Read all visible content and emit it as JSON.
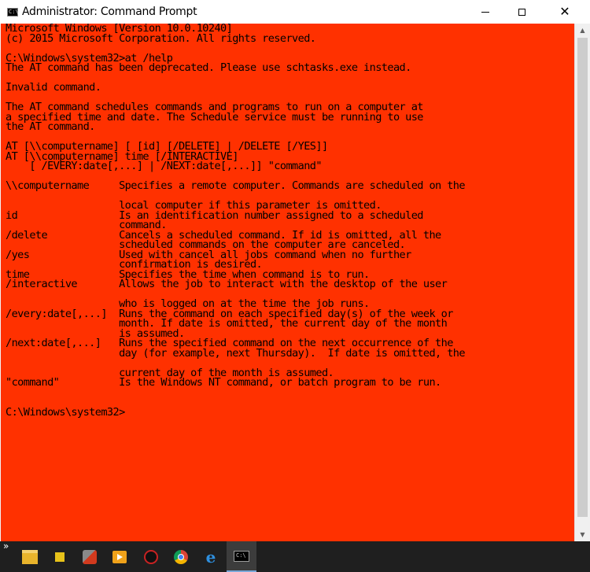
{
  "window": {
    "title": "Administrator: Command Prompt",
    "icon": "cmd-icon",
    "controls": {
      "minimize": "minimize-icon",
      "maximize": "maximize-icon",
      "close_glyph": "✕"
    }
  },
  "console": {
    "background_color": "#ff3100",
    "text_color": "#000000",
    "lines": [
      "Microsoft Windows [Version 10.0.10240]",
      "(c) 2015 Microsoft Corporation. All rights reserved.",
      "",
      "C:\\Windows\\system32>at /help",
      "The AT command has been deprecated. Please use schtasks.exe instead.",
      "",
      "Invalid command.",
      "",
      "The AT command schedules commands and programs to run on a computer at",
      "a specified time and date. The Schedule service must be running to use",
      "the AT command.",
      "",
      "AT [\\\\computername] [ [id] [/DELETE] | /DELETE [/YES]]",
      "AT [\\\\computername] time [/INTERACTIVE]",
      "    [ /EVERY:date[,...] | /NEXT:date[,...]] \"command\"",
      "",
      "\\\\computername     Specifies a remote computer. Commands are scheduled on the",
      "",
      "                   local computer if this parameter is omitted.",
      "id                 Is an identification number assigned to a scheduled",
      "                   command.",
      "/delete            Cancels a scheduled command. If id is omitted, all the",
      "                   scheduled commands on the computer are canceled.",
      "/yes               Used with cancel all jobs command when no further",
      "                   confirmation is desired.",
      "time               Specifies the time when command is to run.",
      "/interactive       Allows the job to interact with the desktop of the user",
      "",
      "                   who is logged on at the time the job runs.",
      "/every:date[,...]  Runs the command on each specified day(s) of the week or",
      "                   month. If date is omitted, the current day of the month",
      "                   is assumed.",
      "/next:date[,...]   Runs the specified command on the next occurrence of the",
      "                   day (for example, next Thursday).  If date is omitted, the",
      "",
      "                   current day of the month is assumed.",
      "\"command\"          Is the Windows NT command, or batch program to be run.",
      "",
      "",
      "C:\\Windows\\system32>"
    ]
  },
  "scrollbar": {
    "up_arrow": "▲",
    "down_arrow": "▼"
  },
  "taskbar": {
    "overflow_glyph": "»",
    "items": [
      {
        "name": "file-explorer-icon",
        "active": false
      },
      {
        "name": "puzzle-app-icon",
        "active": false
      },
      {
        "name": "tools-app-icon",
        "active": false
      },
      {
        "name": "media-player-icon",
        "active": false
      },
      {
        "name": "record-app-icon",
        "active": false
      },
      {
        "name": "chrome-icon",
        "active": false
      },
      {
        "name": "internet-explorer-icon",
        "active": false,
        "glyph": "e"
      },
      {
        "name": "command-prompt-icon",
        "active": true,
        "glyph": "C:\\"
      }
    ]
  }
}
